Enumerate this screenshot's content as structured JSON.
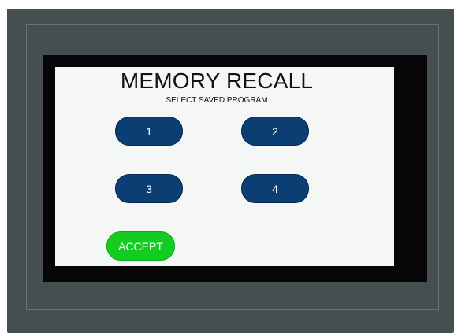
{
  "screen": {
    "title": "MEMORY RECALL",
    "subtitle": "SELECT SAVED PROGRAM"
  },
  "programs": [
    {
      "label": "1"
    },
    {
      "label": "2"
    },
    {
      "label": "3"
    },
    {
      "label": "4"
    }
  ],
  "actions": {
    "accept_label": "ACCEPT"
  },
  "colors": {
    "device": "#454f52",
    "screen_background": "#f4f7f6",
    "program_button": "#0b3e73",
    "accept_button": "#12cc22"
  }
}
